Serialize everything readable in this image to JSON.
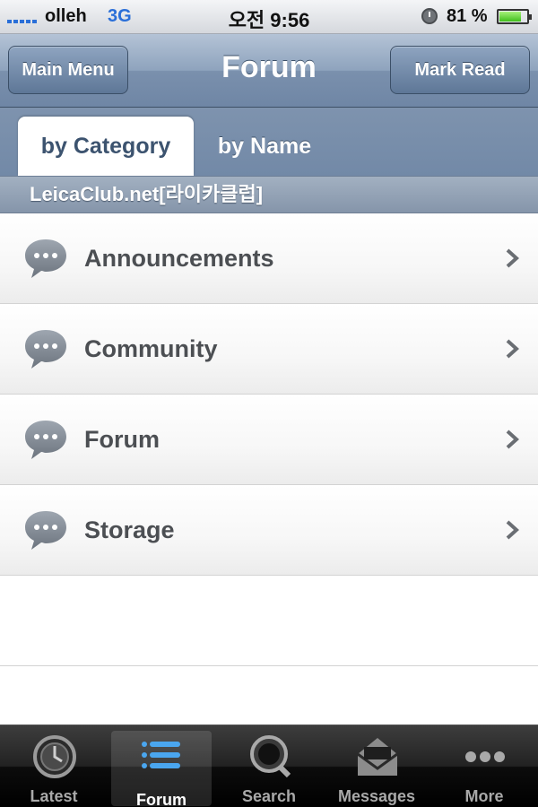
{
  "status_bar": {
    "carrier": "olleh",
    "network": "3G",
    "time": "오전 9:56",
    "battery": "81 %",
    "battery_level": 0.81
  },
  "nav": {
    "title": "Forum",
    "left_button": "Main Menu",
    "right_button": "Mark Read"
  },
  "tabs": {
    "by_category": "by Category",
    "by_name": "by Name",
    "selected": "by Category"
  },
  "section": {
    "title": "LeicaClub.net[라이카클럽]"
  },
  "forums": [
    {
      "label": "Announcements",
      "icon": "speech-bubble-icon"
    },
    {
      "label": "Community",
      "icon": "speech-bubble-icon"
    },
    {
      "label": "Forum",
      "icon": "speech-bubble-icon"
    },
    {
      "label": "Storage",
      "icon": "speech-bubble-icon"
    }
  ],
  "tab_bar": {
    "items": [
      {
        "label": "Latest",
        "icon": "clock-icon"
      },
      {
        "label": "Forum",
        "icon": "list-icon"
      },
      {
        "label": "Search",
        "icon": "search-icon"
      },
      {
        "label": "Messages",
        "icon": "envelope-icon"
      },
      {
        "label": "More",
        "icon": "more-icon"
      }
    ],
    "active": "Forum"
  },
  "colors": {
    "nav_blue": "#7a90ad",
    "network_blue": "#2a6fd8",
    "row_text": "#4c4f53"
  }
}
